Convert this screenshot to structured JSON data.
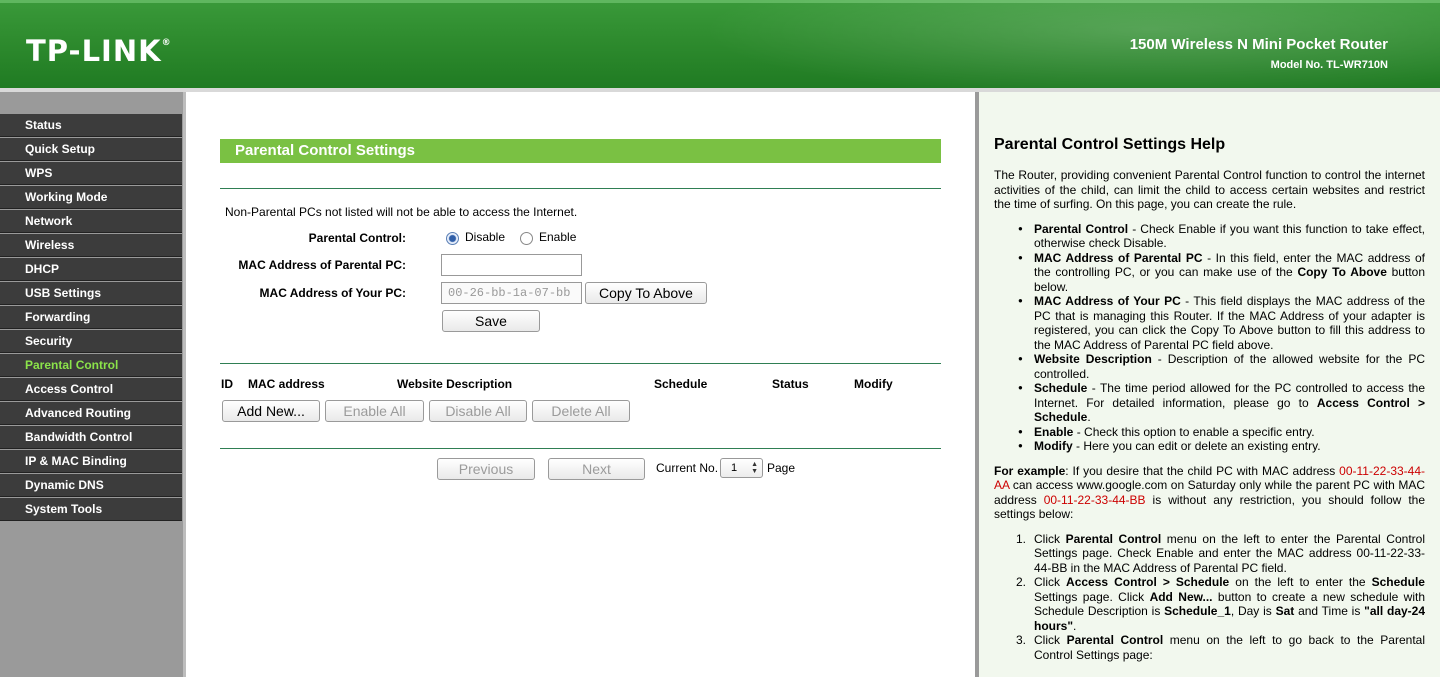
{
  "header": {
    "logo": "TP-LINK",
    "logo_mark": "®",
    "product": "150M Wireless N Mini Pocket Router",
    "model": "Model No. TL-WR710N"
  },
  "sidebar": {
    "items": [
      {
        "label": "Status"
      },
      {
        "label": "Quick Setup"
      },
      {
        "label": "WPS"
      },
      {
        "label": "Working Mode"
      },
      {
        "label": "Network"
      },
      {
        "label": "Wireless"
      },
      {
        "label": "DHCP"
      },
      {
        "label": "USB Settings"
      },
      {
        "label": "Forwarding"
      },
      {
        "label": "Security"
      },
      {
        "label": "Parental Control",
        "active": true
      },
      {
        "label": "Access Control"
      },
      {
        "label": "Advanced Routing"
      },
      {
        "label": "Bandwidth Control"
      },
      {
        "label": "IP & MAC Binding"
      },
      {
        "label": "Dynamic DNS"
      },
      {
        "label": "System Tools"
      }
    ]
  },
  "main": {
    "title": "Parental Control Settings",
    "note": "Non-Parental PCs not listed will not be able to access the Internet.",
    "parental_control_label": "Parental Control:",
    "disable_label": "Disable",
    "enable_label": "Enable",
    "selected": "Disable",
    "mac_parent_label": "MAC Address of Parental PC:",
    "mac_parent_value": "",
    "mac_your_label": "MAC Address of Your PC:",
    "mac_your_value": "00-26-bb-1a-07-bb",
    "copy_button": "Copy To Above",
    "save_button": "Save",
    "table_headers": {
      "id": "ID",
      "mac": "MAC address",
      "website": "Website Description",
      "schedule": "Schedule",
      "status": "Status",
      "modify": "Modify"
    },
    "add_new": "Add New...",
    "enable_all": "Enable All",
    "disable_all": "Disable All",
    "delete_all": "Delete All",
    "previous": "Previous",
    "next": "Next",
    "current_no_label": "Current No.",
    "current_no": "1",
    "page_label": "Page"
  },
  "help": {
    "title": "Parental Control Settings Help",
    "intro": "The Router, providing convenient Parental Control function to control the internet activities of the child, can limit the child to access certain websites and restrict the time of surfing. On this page, you can create the rule.",
    "b1_term": "Parental Control",
    "b1_text": " - Check Enable if you want this function to take effect, otherwise check Disable.",
    "b2_term": "MAC Address of Parental PC",
    "b2_text": " - In this field, enter the MAC address of the controlling PC, or you can make use of the ",
    "b2_term2": "Copy To Above",
    "b2_text2": " button below.",
    "b3_term": "MAC Address of Your PC",
    "b3_text": " - This field displays the MAC address of the PC that is managing this Router. If the MAC Address of your adapter is registered, you can click the Copy To Above button to fill this address to the MAC Address of Parental PC field above.",
    "b4_term": "Website Description",
    "b4_text": " - Description of the allowed website for the PC controlled.",
    "b5_term": "Schedule",
    "b5_text": " - The time period allowed for the PC controlled to access the Internet. For detailed information, please go to ",
    "b5_term2": "Access Control > Schedule",
    "b5_text2": ".",
    "b6_term": "Enable",
    "b6_text": " - Check this option to enable a specific entry.",
    "b7_term": "Modify",
    "b7_text": " - Here you can edit or delete an existing entry.",
    "ex_term": "For example",
    "ex_t1": ": If you desire that the child PC with MAC address ",
    "ex_mac1": "00-11-22-33-44-AA",
    "ex_t2": " can access www.google.com on Saturday only while the parent PC with MAC address ",
    "ex_mac2": "00-11-22-33-44-BB",
    "ex_t3": " is without any restriction, you should follow the settings below:",
    "s1_num": "1.",
    "s1_a": "Click ",
    "s1_b": "Parental Control",
    "s1_c": " menu on the left to enter the Parental Control Settings page. Check Enable and enter the MAC address 00-11-22-33-44-BB in the MAC Address of Parental PC field.",
    "s2_num": "2.",
    "s2_a": "Click ",
    "s2_b": "Access Control > Schedule",
    "s2_c": " on the left to enter the ",
    "s2_d": "Schedule",
    "s2_e": " Settings page. Click ",
    "s2_f": "Add New...",
    "s2_g": " button to create a new schedule with Schedule Description is ",
    "s2_h": "Schedule_1",
    "s2_i": ", Day is ",
    "s2_j": "Sat",
    "s2_k": " and Time is ",
    "s2_l": "\"all day-24 hours\"",
    "s2_m": ".",
    "s3_num": "3.",
    "s3_a": "Click ",
    "s3_b": "Parental Control",
    "s3_c": " menu on the left to go back to the Parental Control Settings page:"
  },
  "colors": {
    "header_green": "#2e8b2e",
    "title_green": "#7ac143",
    "menu_bg": "#3c3c3c",
    "menu_active": "#8be34a",
    "help_bg": "#f2f8ee",
    "example_red": "#cc0000"
  }
}
